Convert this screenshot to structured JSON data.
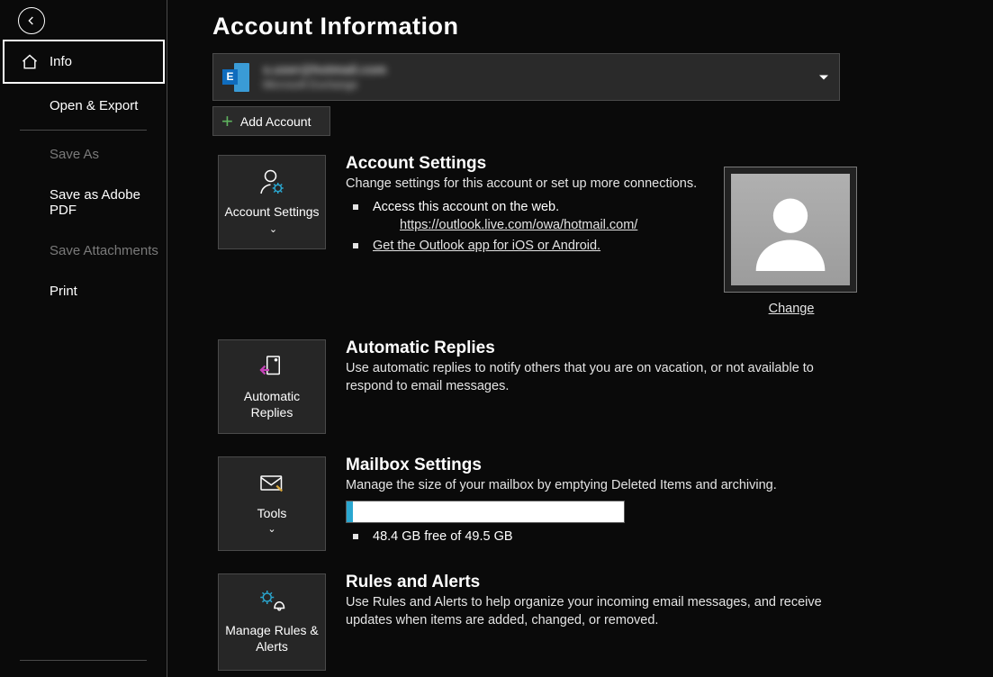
{
  "sidebar": {
    "items": [
      {
        "label": "Info"
      },
      {
        "label": "Open & Export"
      },
      {
        "label": "Save As"
      },
      {
        "label": "Save as Adobe PDF"
      },
      {
        "label": "Save Attachments"
      },
      {
        "label": "Print"
      }
    ]
  },
  "header": {
    "title": "Account Information"
  },
  "account": {
    "line1": "s.user@hotmail.com",
    "line2": "Microsoft Exchange",
    "add_label": "Add Account"
  },
  "settings": {
    "title": "Account Settings",
    "desc": "Change settings for this account or set up more connections.",
    "bullet1": "Access this account on the web.",
    "owa_link": "https://outlook.live.com/owa/hotmail.com/",
    "app_link": "Get the Outlook app for iOS or Android.",
    "tile": "Account Settings",
    "change": "Change"
  },
  "replies": {
    "title": "Automatic Replies",
    "desc": "Use automatic replies to notify others that you are on vacation, or not available to respond to email messages.",
    "tile": "Automatic Replies"
  },
  "mailbox": {
    "title": "Mailbox Settings",
    "desc": "Manage the size of your mailbox by emptying Deleted Items and archiving.",
    "free_text": "48.4 GB free of 49.5 GB",
    "tile": "Tools"
  },
  "rules": {
    "title": "Rules and Alerts",
    "desc": "Use Rules and Alerts to help organize your incoming email messages, and receive updates when items are added, changed, or removed.",
    "tile": "Manage Rules & Alerts"
  }
}
